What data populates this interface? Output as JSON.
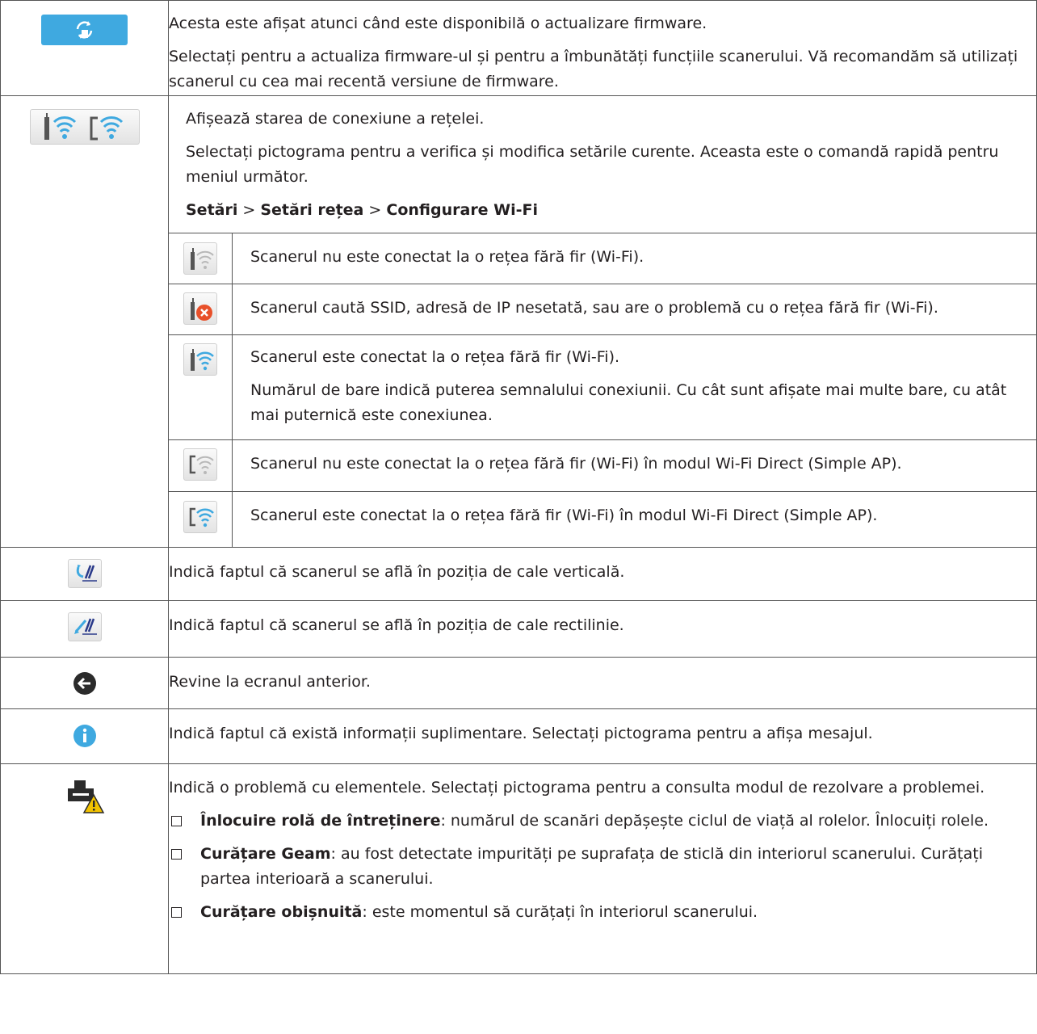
{
  "rows": {
    "firmware": {
      "icon": "firmware-update-icon",
      "line1": "Acesta este afișat atunci când este disponibilă o actualizare firmware.",
      "line2": "Selectați pentru a actualiza firmware-ul și pentru a îmbunătăți funcțiile scanerului. Vă recomandăm să utilizați scanerul cu cea mai recentă versiune de firmware."
    },
    "network": {
      "icon": "network-status-icon",
      "line1": "Afișează starea de conexiune a rețelei.",
      "line2": "Selectați pictograma pentru a verifica și modifica setările curente. Aceasta este o comandă rapidă pentru meniul următor.",
      "path": {
        "p1": "Setări",
        "sep1": " > ",
        "p2": "Setări rețea",
        "sep2": " > ",
        "p3": "Configurare Wi-Fi"
      },
      "sub": [
        {
          "icon": "wifi-disconnected-icon",
          "text": "Scanerul nu este conectat la o rețea fără fir (Wi-Fi)."
        },
        {
          "icon": "wifi-error-icon",
          "text": "Scanerul caută SSID, adresă de IP nesetată, sau are o problemă cu o rețea fără fir (Wi-Fi)."
        },
        {
          "icon": "wifi-connected-icon",
          "text": "Scanerul este conectat la o rețea fără fir (Wi-Fi).",
          "text2": "Numărul de bare indică puterea semnalului conexiunii. Cu cât sunt afișate mai multe bare, cu atât mai puternică este conexiunea."
        },
        {
          "icon": "wifi-direct-disconnected-icon",
          "text": "Scanerul nu este conectat la o rețea fără fir (Wi-Fi) în modul Wi-Fi Direct (Simple AP)."
        },
        {
          "icon": "wifi-direct-connected-icon",
          "text": "Scanerul este conectat la o rețea fără fir (Wi-Fi) în modul Wi-Fi Direct (Simple AP)."
        }
      ]
    },
    "vertical": {
      "icon": "vertical-path-icon",
      "text": "Indică faptul că scanerul se află în poziția de cale verticală."
    },
    "straight": {
      "icon": "straight-path-icon",
      "text": "Indică faptul că scanerul se află în poziția de cale rectilinie."
    },
    "back": {
      "icon": "back-arrow-icon",
      "text": "Revine la ecranul anterior."
    },
    "info": {
      "icon": "info-icon",
      "text": "Indică faptul că există informații suplimentare. Selectați pictograma pentru a afișa mesajul."
    },
    "problem": {
      "icon": "scanner-warning-icon",
      "text": "Indică o problemă cu elementele. Selectați pictograma pentru a consulta modul de rezolvare a problemei.",
      "items": [
        {
          "label": "Înlocuire rolă de întreținere",
          "desc": ": numărul de scanări depășește ciclul de viață al rolelor. Înlocuiți rolele."
        },
        {
          "label": "Curățare Geam",
          "desc": ": au fost detectate impurități pe suprafața de sticlă din interiorul scanerului. Curățați partea interioară a scanerului."
        },
        {
          "label": "Curățare obișnuită",
          "desc": ": este momentul să curățați în interiorul scanerului."
        }
      ]
    }
  },
  "colors": {
    "accent": "#3fa9e0",
    "error": "#e8502a",
    "warning": "#f2c200",
    "border": "#555555"
  }
}
